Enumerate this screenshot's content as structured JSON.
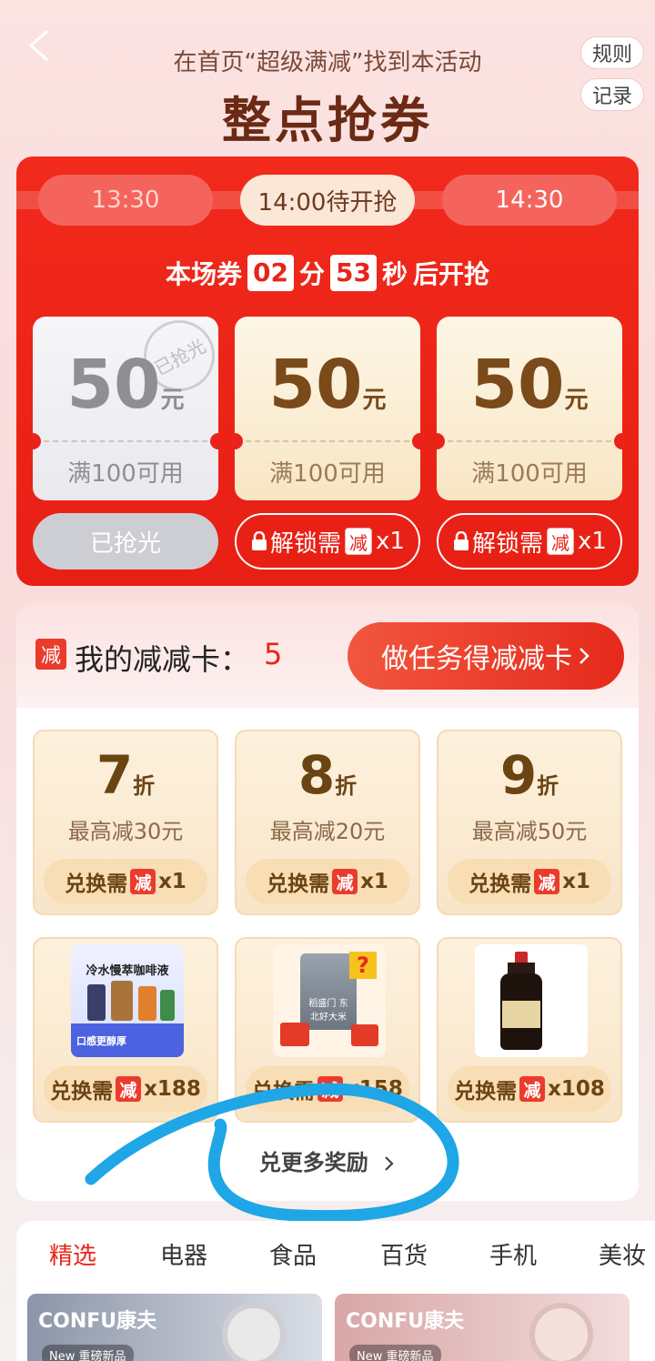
{
  "header": {
    "hint": "在首页“超级满减”找到本活动",
    "title": "整点抢券",
    "rules_label": "规则",
    "record_label": "记录"
  },
  "session": {
    "times": [
      "13:30",
      "14:00待开抢",
      "14:30"
    ],
    "countdown_prefix": "本场券",
    "minutes": "02",
    "min_unit": "分",
    "seconds": "53",
    "sec_unit": "秒",
    "countdown_suffix": "后开抢"
  },
  "coupons": [
    {
      "amount": "50",
      "unit": "元",
      "condition": "满100可用",
      "stamp": "已抢光",
      "button": "已抢光"
    },
    {
      "amount": "50",
      "unit": "元",
      "condition": "满100可用",
      "button_prefix": "解锁需",
      "badge": "减",
      "button_suffix": "x1"
    },
    {
      "amount": "50",
      "unit": "元",
      "condition": "满100可用",
      "button_prefix": "解锁需",
      "badge": "减",
      "button_suffix": "x1"
    }
  ],
  "cards": {
    "badge": "减",
    "title": "我的减减卡：",
    "count": "5",
    "task_button": "做任务得减减卡"
  },
  "discounts": [
    {
      "rate": "7",
      "zhe": "折",
      "max": "最高减30元",
      "exch_prefix": "兑换需",
      "badge": "减",
      "cost": "x1"
    },
    {
      "rate": "8",
      "zhe": "折",
      "max": "最高减20元",
      "exch_prefix": "兑换需",
      "badge": "减",
      "cost": "x1"
    },
    {
      "rate": "9",
      "zhe": "折",
      "max": "最高减50元",
      "exch_prefix": "兑换需",
      "badge": "减",
      "cost": "x1"
    }
  ],
  "prizes": [
    {
      "caption": "冷水慢萃咖啡液",
      "sub": "口感更醇厚",
      "exch_prefix": "兑换需",
      "badge": "减",
      "cost": "x188"
    },
    {
      "caption": "稻盛门 东北好大米",
      "exch_prefix": "兑换需",
      "badge": "减",
      "cost": "x158"
    },
    {
      "caption": "酱油",
      "exch_prefix": "兑换需",
      "badge": "减",
      "cost": "x108"
    }
  ],
  "more_label": "兑更多奖励",
  "categories": [
    "精选",
    "电器",
    "食品",
    "百货",
    "手机",
    "美妆"
  ],
  "products": [
    {
      "brand": "CONFU康夫",
      "tag": "New 重磅新品"
    },
    {
      "brand": "CONFU康夫",
      "tag": "New 重磅新品"
    }
  ],
  "colors": {
    "primary_red": "#e8241a",
    "annotation_blue": "#1fa6e6"
  }
}
